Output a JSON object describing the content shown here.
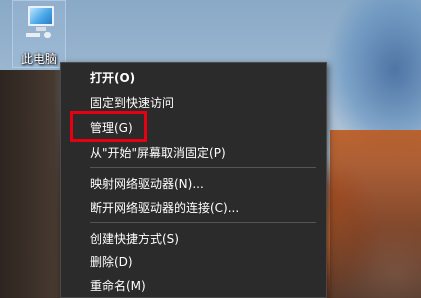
{
  "desktop": {
    "icon": {
      "label": "此电脑",
      "icon_name": "computer-icon"
    }
  },
  "context_menu": {
    "items": [
      {
        "label": "打开(O)",
        "bold": true
      },
      {
        "label": "固定到快速访问"
      },
      {
        "label": "管理(G)",
        "highlighted": true
      },
      {
        "label": "从\"开始\"屏幕取消固定(P)"
      },
      {
        "label": "映射网络驱动器(N)..."
      },
      {
        "label": "断开网络驱动器的连接(C)..."
      },
      {
        "label": "创建快捷方式(S)"
      },
      {
        "label": "删除(D)"
      },
      {
        "label": "重命名(M)"
      }
    ],
    "colors": {
      "background": "#2b2b2b",
      "text": "#ffffff",
      "separator": "#555555"
    }
  },
  "annotation": {
    "highlight_color": "#e60012"
  }
}
